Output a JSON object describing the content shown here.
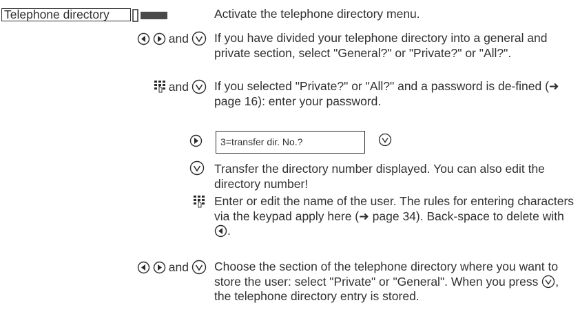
{
  "menu": {
    "label": "Telephone directory"
  },
  "keys": {
    "and": "and"
  },
  "display": {
    "text": "3=transfer dir. No.?"
  },
  "steps": [
    {
      "text": "Activate the telephone directory menu."
    },
    {
      "text": "If you have divided your telephone directory into a general and private section, select \"General?\" or \"Private?\" or \"All?\"."
    },
    {
      "text": "If you selected \"Private?\" or \"All?\" and a password is de-fined (➜ page 16): enter your password."
    },
    {
      "text": "Transfer the directory number displayed. You can also edit the directory number!"
    },
    {
      "text_before": "Enter or edit the name of the user. The rules for entering characters via the keypad apply here (➜ page 34). Back-space to delete with",
      "text_after": "."
    },
    {
      "text_before": "Choose the section of the telephone directory where you want to store the user: select \"Private\" or \"General\". When you press",
      "text_after": ", the telephone directory entry is stored."
    }
  ]
}
